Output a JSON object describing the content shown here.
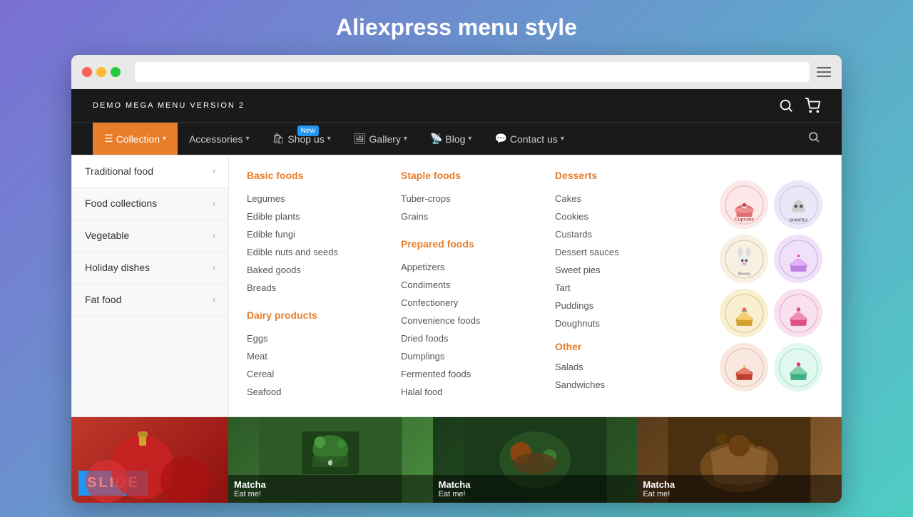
{
  "page": {
    "title": "Aliexpress menu style"
  },
  "browser": {
    "dots": [
      "red",
      "yellow",
      "green"
    ]
  },
  "navbar": {
    "logo": "DEMO MEGA MENU VERSION 2"
  },
  "menubar": {
    "items": [
      {
        "id": "collection",
        "label": "Collection",
        "active": true,
        "badge": null,
        "icon": "☰"
      },
      {
        "id": "accessories",
        "label": "Accessories",
        "active": false,
        "badge": null
      },
      {
        "id": "shop-us",
        "label": "Shop us",
        "active": false,
        "badge": "New",
        "icon": "🛍"
      },
      {
        "id": "gallery",
        "label": "Gallery",
        "active": false,
        "badge": null,
        "icon": "🖼"
      },
      {
        "id": "blog",
        "label": "Blog",
        "active": false,
        "badge": null,
        "icon": "📡"
      },
      {
        "id": "contact",
        "label": "Contact us",
        "active": false,
        "badge": null,
        "icon": "💬"
      }
    ]
  },
  "dropdown": {
    "sidebar": [
      {
        "id": "traditional-food",
        "label": "Traditional food",
        "active": true
      },
      {
        "id": "food-collections",
        "label": "Food collections",
        "active": false
      },
      {
        "id": "vegetable",
        "label": "Vegetable",
        "active": false
      },
      {
        "id": "holiday-dishes",
        "label": "Holiday dishes",
        "active": false
      },
      {
        "id": "fat-food",
        "label": "Fat food",
        "active": false
      }
    ],
    "columns": [
      {
        "id": "basic-foods",
        "heading": "Basic foods",
        "items": [
          "Legumes",
          "Edible plants",
          "Edible fungi",
          "Edible nuts and seeds",
          "Baked goods",
          "Breads"
        ]
      },
      {
        "id": "dairy-products",
        "heading": "Dairy products",
        "items": [
          "Eggs",
          "Meat",
          "Cereal",
          "Seafood"
        ]
      },
      {
        "id": "staple-foods",
        "heading": "Staple foods",
        "items": [
          "Tuber-crops",
          "Grains"
        ]
      },
      {
        "id": "prepared-foods",
        "heading": "Prepared foods",
        "items": [
          "Appetizers",
          "Condiments",
          "Confectionery",
          "Convenience foods",
          "Dried foods",
          "Dumplings",
          "Fermented foods",
          "Halal food"
        ]
      },
      {
        "id": "desserts",
        "heading": "Desserts",
        "items": [
          "Cakes",
          "Cookies",
          "Custards",
          "Dessert sauces",
          "Sweet pies",
          "Tart",
          "Puddings",
          "Doughnuts"
        ]
      },
      {
        "id": "other",
        "heading": "Other",
        "items": [
          "Salads",
          "Sandwiches"
        ]
      }
    ],
    "logos": [
      {
        "id": "logo1",
        "label": "Cupcake House",
        "color": "#f5c0c0"
      },
      {
        "id": "logo2",
        "label": "Ghostly Cupcakes",
        "color": "#d0d0e8"
      },
      {
        "id": "logo3",
        "label": "Bunny Cakes",
        "color": "#f0e8d0"
      },
      {
        "id": "logo4",
        "label": "Cupcake House 2",
        "color": "#d8c8e8"
      },
      {
        "id": "logo5",
        "label": "Cupcake Gold",
        "color": "#f5e8c0"
      },
      {
        "id": "logo6",
        "label": "Cupcake Pink",
        "color": "#f5c8e0"
      },
      {
        "id": "logo7",
        "label": "Cupcake Red",
        "color": "#f5c0c0"
      },
      {
        "id": "logo8",
        "label": "Cupcake Mint",
        "color": "#c0f0e0"
      }
    ]
  },
  "slides": [
    {
      "id": "slide1",
      "label": "SLIDE",
      "color": "#2196F3"
    },
    {
      "id": "slide2",
      "title": "Matcha",
      "subtitle": "Eat me!",
      "bg": "green"
    },
    {
      "id": "slide3",
      "title": "Matcha",
      "subtitle": "Eat me!",
      "bg": "darkgreen"
    },
    {
      "id": "slide4",
      "title": "Matcha",
      "subtitle": "Eat me!",
      "bg": "brown"
    }
  ]
}
